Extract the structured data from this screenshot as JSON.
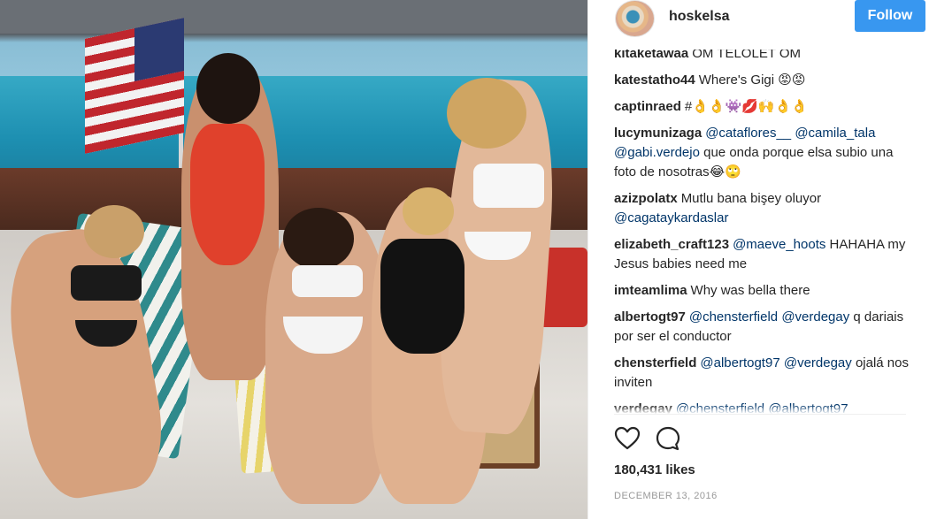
{
  "post": {
    "photo_alt": "photo",
    "header": {
      "username": "hoskelsa",
      "follow_label": "Follow",
      "follow_color": "#3897f0"
    },
    "comments": [
      {
        "author": "kitaketawaa",
        "parts": [
          {
            "t": "OM TELOLET OM"
          }
        ]
      },
      {
        "author": "katestatho44",
        "parts": [
          {
            "t": "Where's Gigi 😡😡"
          }
        ]
      },
      {
        "author": "captinraed",
        "parts": [
          {
            "t": "#👌👌👾💋🙌👌👌"
          }
        ]
      },
      {
        "author": "lucymunizaga",
        "parts": [
          {
            "t": "@cataflores__",
            "m": true
          },
          {
            "t": " "
          },
          {
            "t": "@camila_tala",
            "m": true
          },
          {
            "t": " "
          },
          {
            "t": "@gabi.verdejo",
            "m": true
          },
          {
            "t": " que onda porque elsa subio una foto de nosotras😂🙄"
          }
        ]
      },
      {
        "author": "azizpolatx",
        "parts": [
          {
            "t": "Mutlu bana bişey oluyor "
          },
          {
            "t": "@cagataykardaslar",
            "m": true
          }
        ]
      },
      {
        "author": "elizabeth_craft123",
        "parts": [
          {
            "t": "@maeve_hoots",
            "m": true
          },
          {
            "t": " HAHAHA my Jesus babies need me"
          }
        ]
      },
      {
        "author": "imteamlima",
        "parts": [
          {
            "t": "Why was bella there"
          }
        ]
      },
      {
        "author": "albertogt97",
        "parts": [
          {
            "t": "@chensterfield",
            "m": true
          },
          {
            "t": " "
          },
          {
            "t": "@verdegay",
            "m": true
          },
          {
            "t": " q dariais por ser el conductor"
          }
        ]
      },
      {
        "author": "chensterfield",
        "parts": [
          {
            "t": "@albertogt97",
            "m": true
          },
          {
            "t": " "
          },
          {
            "t": "@verdegay",
            "m": true
          },
          {
            "t": " ojalá nos inviten"
          }
        ]
      },
      {
        "author": "verdegay",
        "parts": [
          {
            "t": "@chensterfield",
            "m": true
          },
          {
            "t": " "
          },
          {
            "t": "@albertogt97",
            "m": true
          }
        ]
      }
    ],
    "actions": {
      "like_icon": "heart-outline-icon",
      "comment_icon": "speech-bubble-icon"
    },
    "likes_text": "180,431 likes",
    "date_text": "DECEMBER 13, 2016"
  }
}
